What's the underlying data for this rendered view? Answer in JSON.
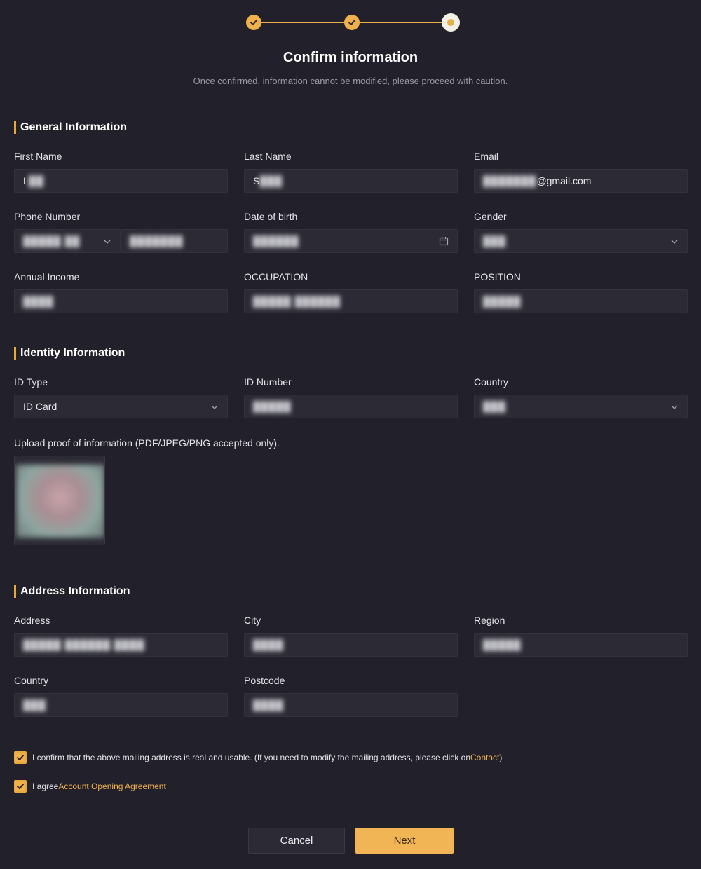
{
  "header": {
    "title": "Confirm information",
    "subtitle": "Once confirmed, information cannot be modified, please proceed with caution."
  },
  "general": {
    "section_title": "General Information",
    "first_name": {
      "label": "First Name",
      "value": "L"
    },
    "last_name": {
      "label": "Last Name",
      "value": "S"
    },
    "email": {
      "label": "Email",
      "value": "@gmail.com"
    },
    "phone": {
      "label": "Phone Number"
    },
    "dob": {
      "label": "Date of birth"
    },
    "gender": {
      "label": "Gender"
    },
    "annual_income": {
      "label": "Annual Income"
    },
    "occupation": {
      "label": "OCCUPATION"
    },
    "position": {
      "label": "POSITION"
    }
  },
  "identity": {
    "section_title": "Identity Information",
    "id_type": {
      "label": "ID Type",
      "value": "ID Card"
    },
    "id_number": {
      "label": "ID Number"
    },
    "country": {
      "label": "Country"
    },
    "upload_label": "Upload proof of information (PDF/JPEG/PNG accepted only)."
  },
  "address": {
    "section_title": "Address Information",
    "address": {
      "label": "Address"
    },
    "city": {
      "label": "City"
    },
    "region": {
      "label": "Region"
    },
    "country": {
      "label": "Country"
    },
    "postcode": {
      "label": "Postcode"
    }
  },
  "confirmations": {
    "mailing_text": "I confirm that the above mailing address is real and usable. (If you need to modify the mailing address, please click on",
    "mailing_link": "Contact",
    "mailing_close": ")",
    "agree_text": "I agree",
    "agree_link": "Account Opening Agreement"
  },
  "actions": {
    "cancel_label": "Cancel",
    "next_label": "Next"
  },
  "colors": {
    "accent": "#f0b04c",
    "background": "#22212b",
    "field": "#2c2b35"
  }
}
